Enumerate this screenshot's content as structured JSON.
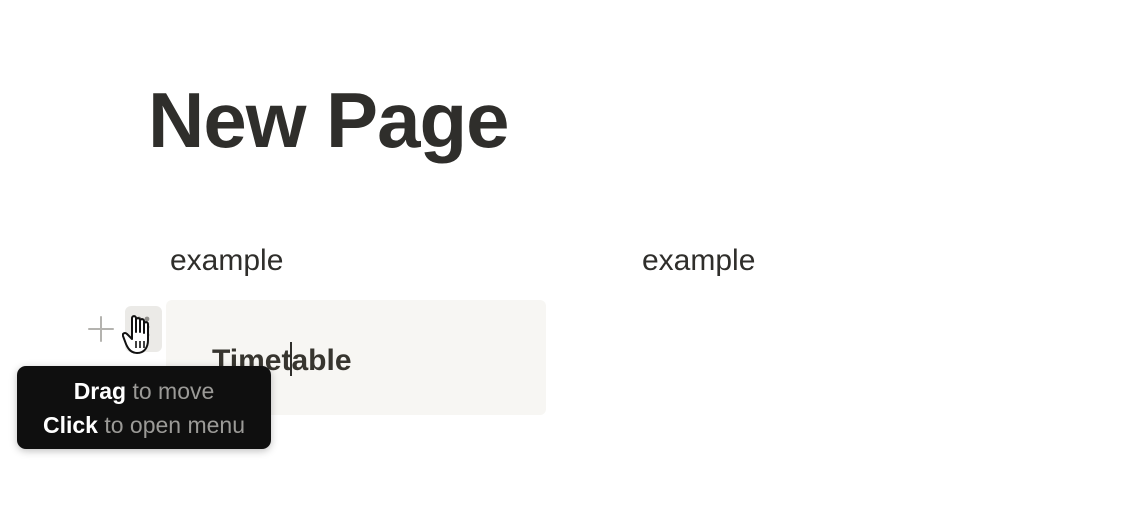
{
  "page": {
    "title": "New Page"
  },
  "columns": {
    "left_text": "example",
    "right_text": "example"
  },
  "block": {
    "text_before_caret": "Timet",
    "text_after_caret": "able"
  },
  "handles": {
    "add_icon": "plus-icon",
    "drag_icon": "grip-dots-icon",
    "cursor_icon": "hand-pointer-cursor"
  },
  "tooltip": {
    "line1_action": "Drag",
    "line1_rest": " to move",
    "line2_action": "Click",
    "line2_rest": " to open menu"
  },
  "colors": {
    "text": "#37352f",
    "block_bg": "#f7f6f3",
    "handle_bg": "#ebeae7",
    "tooltip_bg": "#0f0f0f",
    "tooltip_muted": "#9b9a97"
  }
}
